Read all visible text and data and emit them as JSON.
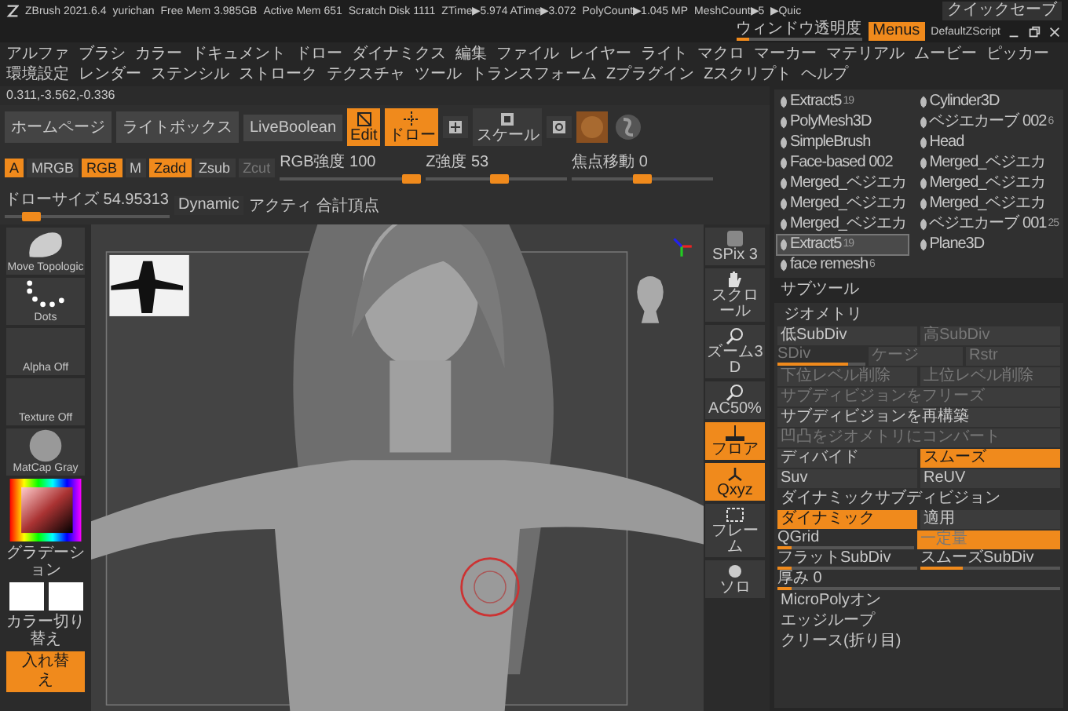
{
  "title_bar": {
    "app": "ZBrush 2021.6.4",
    "user": "yurichan",
    "stats": [
      "Free Mem 3.985GB",
      "Active Mem 651",
      "Scratch Disk 1111",
      "ZTime▶5.974 ATime▶3.072",
      "PolyCount▶1.045 MP",
      "MeshCount▶5",
      "▶Quic"
    ],
    "quick_save": "クイックセーブ",
    "transparency": {
      "label": "ウィンドウ透明度",
      "level": 0.1
    },
    "menus_toggle": {
      "label": "Menus",
      "on": true
    },
    "script": "DefaultZScript"
  },
  "menus": [
    "アルファ",
    "ブラシ",
    "カラー",
    "ドキュメント",
    "ドロー",
    "ダイナミクス",
    "編集",
    "ファイル",
    "レイヤー",
    "ライト",
    "マクロ",
    "マーカー",
    "マテリアル",
    "ムービー",
    "ピッカー",
    "環境設定",
    "レンダー",
    "ステンシル",
    "ストローク",
    "テクスチャ",
    "ツール",
    "トランスフォーム",
    "Zプラグイン",
    "Zスクリプト",
    "ヘルプ"
  ],
  "coordinates": "0.311,-3.562,-0.336",
  "toolbar": {
    "tabs": [
      "ホームページ",
      "ライトボックス",
      "LiveBoolean"
    ],
    "modes": [
      {
        "kind": "edit",
        "label": "Edit",
        "on": true
      },
      {
        "kind": "draw",
        "label": "ドロー",
        "on": true
      },
      {
        "kind": "move",
        "on": false
      },
      {
        "kind": "scale",
        "label": "スケール",
        "on": false
      },
      {
        "kind": "rotate",
        "on": false
      }
    ],
    "channels": [
      {
        "label": "A",
        "on": true,
        "disabled": false
      },
      {
        "label": "MRGB",
        "on": false,
        "disabled": false
      },
      {
        "label": "RGB",
        "on": true,
        "disabled": false
      },
      {
        "label": "M",
        "on": false,
        "disabled": false
      },
      {
        "label": "Zadd",
        "on": true,
        "disabled": false
      },
      {
        "label": "Zsub",
        "on": false,
        "disabled": false
      },
      {
        "label": "Zcut",
        "on": false,
        "disabled": true
      }
    ],
    "sliders": [
      {
        "label": "RGB強度",
        "value": "100",
        "level": 1.0
      },
      {
        "label": "Z強度",
        "value": "53",
        "level": 0.53
      },
      {
        "label": "焦点移動",
        "value": "0",
        "level": 0.5
      },
      {
        "label": "ドローサイズ",
        "value": "54.95313",
        "level": 0.12
      }
    ],
    "dynamic": "Dynamic",
    "active_points": "アクティ",
    "total_points": "合計頂点"
  },
  "left_shelf": {
    "thumbs": [
      {
        "label": "Move Topologic",
        "kind": "brush"
      },
      {
        "label": "Dots",
        "kind": "stroke"
      },
      {
        "label": "Alpha Off",
        "kind": "empty"
      },
      {
        "label": "Texture Off",
        "kind": "empty"
      },
      {
        "label": "MatCap Gray",
        "kind": "sphere"
      }
    ],
    "gradient": "グラデーション",
    "swap_label": "カラー切り替え",
    "swap_button": "入れ替え"
  },
  "right_strip": [
    {
      "label": "SPix 3",
      "kind": "spix",
      "on": false
    },
    {
      "label": "スクロール",
      "kind": "hand",
      "on": false
    },
    {
      "label": "ズーム3D",
      "kind": "zoom",
      "on": false
    },
    {
      "label": "AC50%",
      "kind": "zoom",
      "on": false
    },
    {
      "label": "フロア",
      "kind": "floor",
      "on": true
    },
    {
      "label": "Qxyz",
      "kind": "axes",
      "on": true
    },
    {
      "label": "フレーム",
      "kind": "frame",
      "on": false
    },
    {
      "label": "ソロ",
      "kind": "solo",
      "on": false
    }
  ],
  "tools": [
    {
      "name": "Extract5",
      "count": "19",
      "selected": false
    },
    {
      "name": "Cylinder3D",
      "selected": false
    },
    {
      "name": "PolyMesh3D",
      "selected": false
    },
    {
      "name": "ベジエカーブ 002",
      "count": "6",
      "selected": false
    },
    {
      "name": "SimpleBrush",
      "selected": false
    },
    {
      "name": "Head",
      "selected": false
    },
    {
      "name": "Face-based 002",
      "selected": false
    },
    {
      "name": "Merged_ベジエカ",
      "selected": false
    },
    {
      "name": "Merged_ベジエカ",
      "selected": false
    },
    {
      "name": "Merged_ベジエカ",
      "selected": false
    },
    {
      "name": "Merged_ベジエカ",
      "selected": false
    },
    {
      "name": "Merged_ベジエカ",
      "selected": false
    },
    {
      "name": "Merged_ベジエカ",
      "selected": false
    },
    {
      "name": "ベジエカーブ 001",
      "count": "25",
      "selected": false
    },
    {
      "name": "Extract5",
      "count": "19",
      "selected": true
    },
    {
      "name": "Plane3D",
      "selected": false
    },
    {
      "name": "face remesh",
      "count": "6",
      "selected": false
    }
  ],
  "subtool_title": "サブツール",
  "geometry": {
    "title": "ジオメトリ",
    "rows": [
      [
        {
          "label": "低SubDiv",
          "kind": "button",
          "on": false,
          "disabled": false
        },
        {
          "label": "高SubDiv",
          "kind": "button",
          "on": false,
          "disabled": true
        }
      ],
      [
        {
          "label": "SDiv",
          "kind": "slider",
          "level": 0.8,
          "disabled": true
        },
        {
          "label": "ケージ",
          "kind": "button",
          "on": false,
          "disabled": true
        },
        {
          "label": "Rstr",
          "kind": "button",
          "on": false,
          "disabled": true
        }
      ],
      [
        {
          "label": "下位レベル削除",
          "kind": "button",
          "on": false,
          "disabled": true
        },
        {
          "label": "上位レベル削除",
          "kind": "button",
          "on": false,
          "disabled": true
        }
      ],
      [
        {
          "label": "サブディビジョンをフリーズ",
          "kind": "button",
          "on": false,
          "disabled": true
        }
      ],
      [
        {
          "label": "サブディビジョンを再構築",
          "kind": "button",
          "on": false,
          "disabled": false
        }
      ],
      [
        {
          "label": "凹凸をジオメトリにコンバート",
          "kind": "button",
          "on": false,
          "disabled": true
        }
      ],
      [
        {
          "label": "ディバイド",
          "kind": "button",
          "on": false,
          "disabled": false
        },
        {
          "label": "スムーズ",
          "kind": "button",
          "on": true,
          "disabled": false
        }
      ],
      [
        {
          "label": "Suv",
          "kind": "button",
          "on": false,
          "disabled": false
        },
        {
          "label": "ReUV",
          "kind": "button",
          "on": false,
          "disabled": false
        }
      ],
      [
        {
          "label": "ダイナミックサブディビジョン",
          "kind": "header",
          "disabled": false
        }
      ],
      [
        {
          "label": "ダイナミック",
          "kind": "button",
          "on": true,
          "disabled": false
        },
        {
          "label": "適用",
          "kind": "button",
          "on": false,
          "disabled": false
        }
      ],
      [
        {
          "label": "QGrid",
          "kind": "slider",
          "level": 0.1,
          "disabled": false
        },
        {
          "label": "一定量",
          "kind": "button",
          "on": true,
          "disabled": true
        }
      ],
      [
        {
          "label": "フラットSubDiv",
          "kind": "slider",
          "level": 0.1,
          "disabled": false
        },
        {
          "label": "スムーズSubDiv",
          "kind": "slider",
          "level": 0.3,
          "disabled": false
        }
      ],
      [
        {
          "label": "厚み 0",
          "kind": "slider",
          "level": 0.05,
          "disabled": false
        }
      ],
      [
        {
          "label": "MicroPolyオン",
          "kind": "header",
          "disabled": false
        }
      ],
      [
        {
          "label": "エッジループ",
          "kind": "header",
          "disabled": false
        }
      ],
      [
        {
          "label": "クリース(折り目)",
          "kind": "header",
          "disabled": false
        }
      ]
    ]
  }
}
